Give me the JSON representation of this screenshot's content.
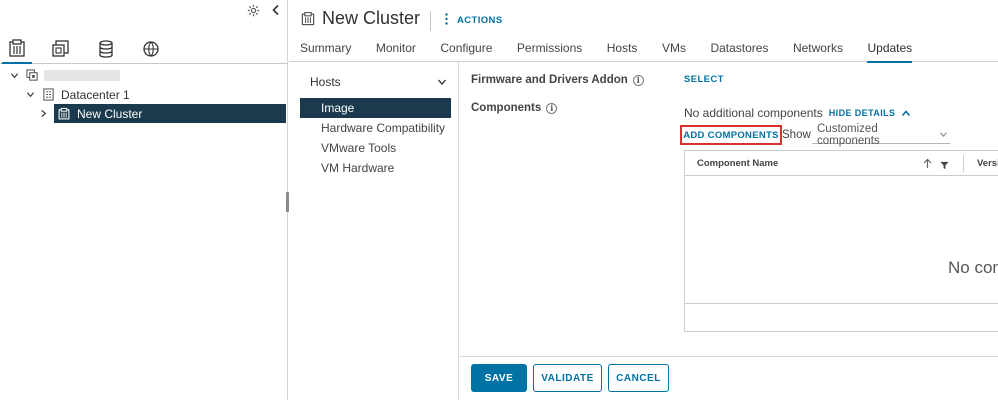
{
  "navigator": {
    "tree": {
      "datacenter_label": "Datacenter 1",
      "cluster_label": "New Cluster"
    }
  },
  "header": {
    "title": "New Cluster",
    "actions_label": "ACTIONS",
    "tabs": [
      "Summary",
      "Monitor",
      "Configure",
      "Permissions",
      "Hosts",
      "VMs",
      "Datastores",
      "Networks",
      "Updates"
    ],
    "active_tab": "Updates"
  },
  "subnav": {
    "section": "Hosts",
    "items": [
      "Image",
      "Hardware Compatibility",
      "VMware Tools",
      "VM Hardware"
    ],
    "active_item": "Image"
  },
  "content": {
    "firmware_label": "Firmware and Drivers Addon",
    "select_link": "SELECT",
    "components_label": "Components",
    "no_components_text": "No additional components",
    "hide_details": "HIDE DETAILS",
    "add_components": "ADD COMPONENTS",
    "show_label": "Show",
    "show_value": "Customized components",
    "grid": {
      "col_name": "Component Name",
      "col_version": "Versi",
      "empty_message": "No com"
    }
  },
  "footer": {
    "save": "SAVE",
    "validate": "VALIDATE",
    "cancel": "CANCEL"
  },
  "colors": {
    "accent": "#0072a3",
    "selection_bg": "#1c3a4d",
    "highlight_box": "#d7312e"
  }
}
